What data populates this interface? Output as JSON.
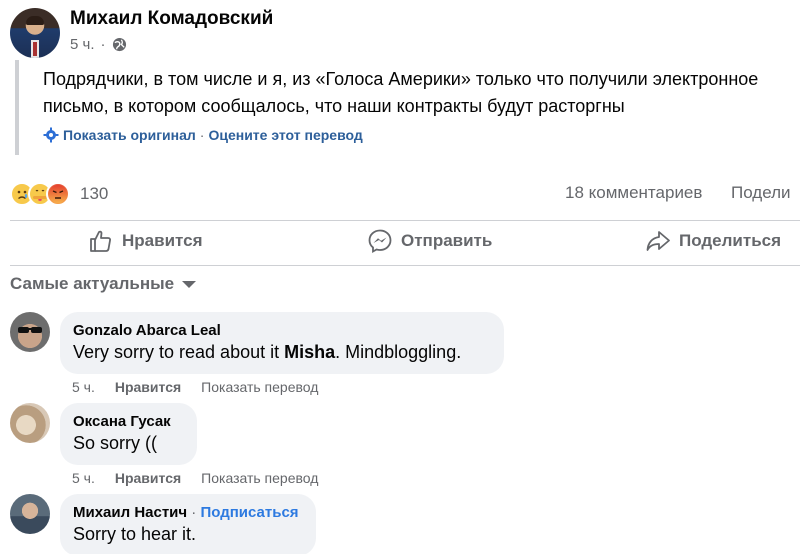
{
  "post": {
    "author": "Михаил Комадовский",
    "time": "5 ч.",
    "meta_sep": "·",
    "text": "Подрядчики, в том числе и я, из «Голоса Америки» только что получили электронное письмо, в котором сообщалось, что наши контракты будут расторгны",
    "show_original": "Показать оригинал",
    "translate_sep": "·",
    "rate_translation": "Оцените этот перевод"
  },
  "stats": {
    "reactions": [
      "sad-emoji",
      "care-emoji",
      "angry-emoji"
    ],
    "reaction_count": "130",
    "comment_count": "18 комментариев",
    "share_count": "Подели"
  },
  "actions": {
    "like": "Нравится",
    "send": "Отправить",
    "share": "Поделиться"
  },
  "sort_label": "Самые актуальные",
  "comments": [
    {
      "name": "Gonzalo Abarca Leal",
      "text_before": "Very sorry to read about it ",
      "text_bold": "Misha",
      "text_after": ". Mindbloggling.",
      "time": "5 ч.",
      "like": "Нравится",
      "translate": "Показать перевод"
    },
    {
      "name": "Оксана Гусак",
      "text": "So sorry ((",
      "time": "5 ч.",
      "like": "Нравится",
      "translate": "Показать перевод"
    },
    {
      "name": "Михаил Настич",
      "sep": "·",
      "follow": "Подписаться",
      "text": "Sorry to hear it."
    }
  ],
  "colors": {
    "link": "#2d5f9a",
    "follow": "#2d7ae0",
    "muted": "#65676b",
    "bubble": "#f0f2f5"
  }
}
